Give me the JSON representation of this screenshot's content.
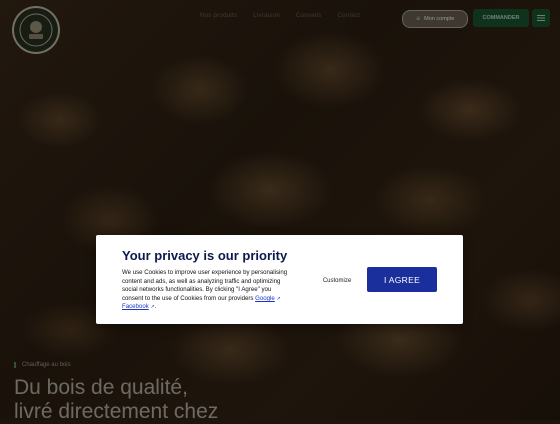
{
  "header": {
    "logo_icon": "lumber-mascot-logo",
    "nav": [
      "Nos produits",
      "Livraison",
      "Conseils",
      "Contact"
    ],
    "login_label": "Mon compte",
    "cta_label": "COMMANDER",
    "menu_icon": "menu-icon"
  },
  "hero": {
    "badge": "Chauffage au bois",
    "title_line1": "Du bois de qualité,",
    "title_line2": "livré directement chez"
  },
  "cookie_modal": {
    "title": "Your privacy is our priority",
    "text_before_links": "We use Cookies to improve user experience by personalising content and ads, as well as analyzing traffic and optimizing social networks functionalities. By clicking \"I Agree\" you consent to the use of Cookies from our providers",
    "link_google": "Google",
    "link_facebook": "Facebook",
    "text_after_links": ".",
    "customize_label": "Customize",
    "agree_label": "I AGREE",
    "colors": {
      "title": "#0a1a4a",
      "agree_bg": "#1a2e9c",
      "link": "#1a35c4"
    }
  }
}
